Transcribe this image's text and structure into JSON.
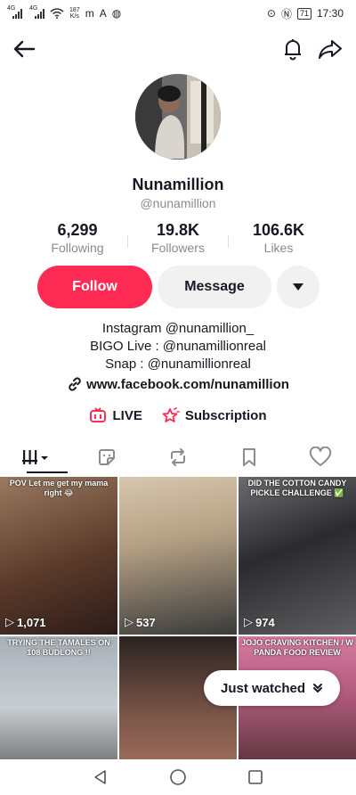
{
  "status_bar": {
    "net_type_1": "4G",
    "net_type_2": "4G",
    "net_speed_value": "187",
    "net_speed_unit": "K/s",
    "battery": "71",
    "time": "17:30"
  },
  "profile": {
    "display_name": "Nunamillion",
    "username": "@nunamillion",
    "stats": [
      {
        "value": "6,299",
        "label": "Following"
      },
      {
        "value": "19.8K",
        "label": "Followers"
      },
      {
        "value": "106.6K",
        "label": "Likes"
      }
    ],
    "follow_label": "Follow",
    "message_label": "Message",
    "bio_lines": [
      "Instagram @nunamillion_",
      "BIGO Live : @nunamillionreal",
      "Snap : @nunamillionreal"
    ],
    "link": "www.facebook.com/nunamillion",
    "live_label": "LIVE",
    "subscription_label": "Subscription"
  },
  "colors": {
    "accent": "#fe2c55",
    "text_primary": "#161823",
    "text_secondary": "#8a8b91"
  },
  "videos": [
    {
      "caption": "POV Let me get my mama right 😂",
      "views": "1,071"
    },
    {
      "caption": "",
      "views": "537"
    },
    {
      "caption": "DID THE COTTON CANDY PICKLE CHALLENGE ✅",
      "views": "974"
    },
    {
      "caption": "TRYING THE TAMALES ON 108 BUDLONG !!",
      "views": ""
    },
    {
      "caption": "",
      "views": ""
    },
    {
      "caption": "JOJO CRAVING KITCHEN / W PANDA FOOD REVIEW",
      "views": ""
    }
  ],
  "just_watched_label": "Just watched",
  "icons": {
    "back": "arrow-left-icon",
    "notifications": "bell-icon",
    "share": "share-arrow-icon",
    "more": "triangle-down-icon",
    "link": "link-icon",
    "live": "tv-live-icon",
    "subscription": "star-badge-icon",
    "tab_videos": "grid-bars-icon",
    "tab_sticker": "sticker-icon",
    "tab_reposts": "repost-icon",
    "tab_favorites": "bookmark-icon",
    "tab_liked": "heart-icon"
  }
}
